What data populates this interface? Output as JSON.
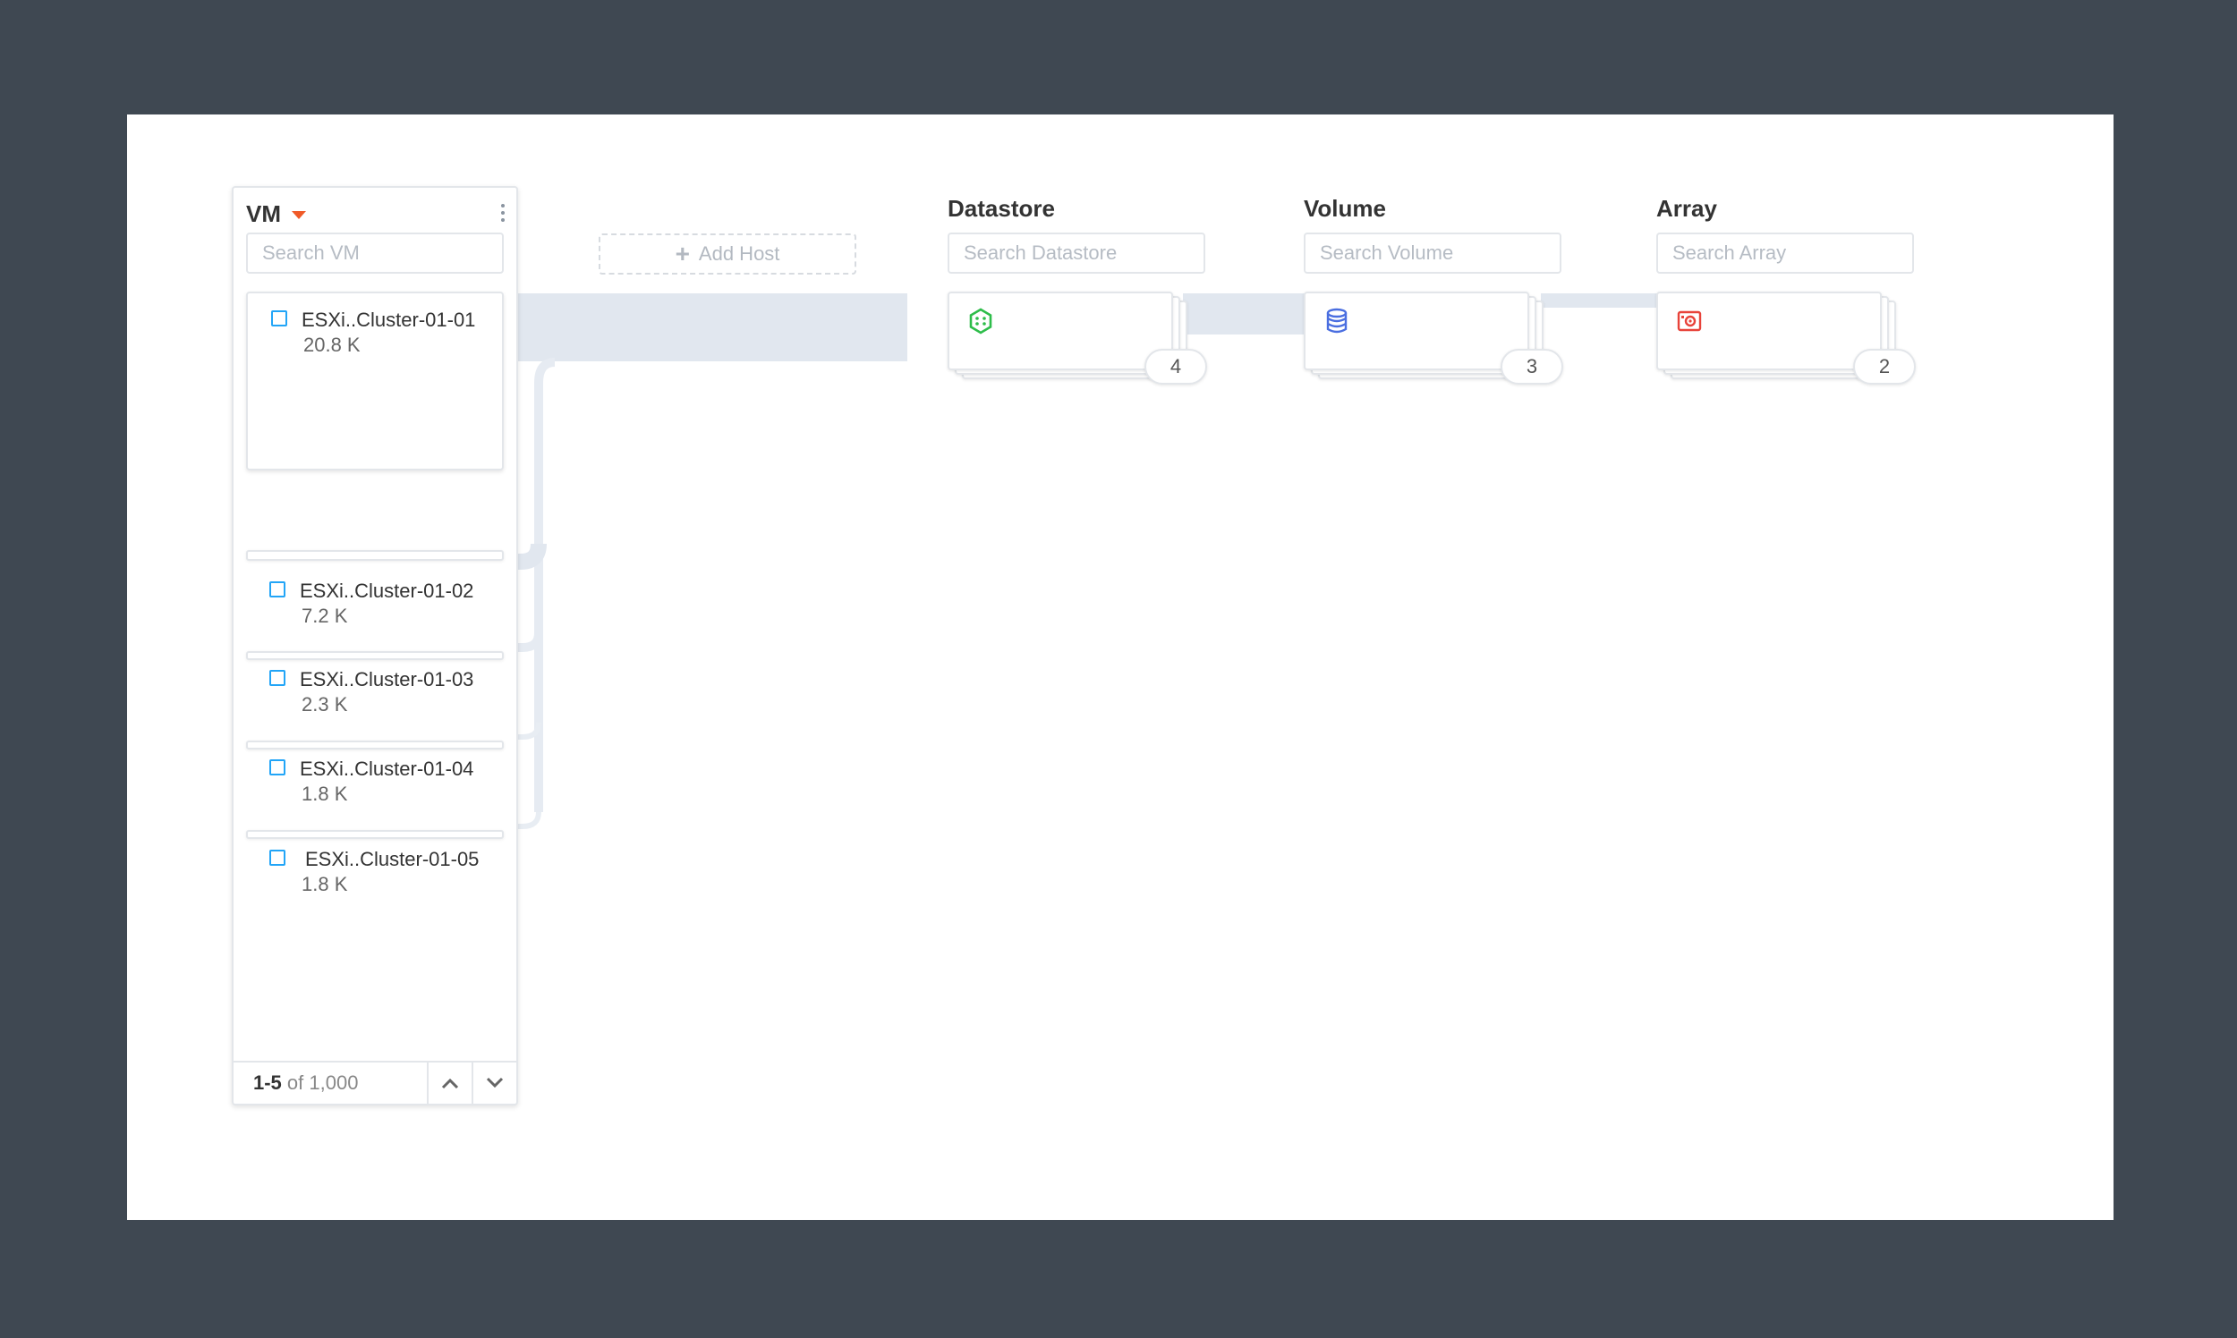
{
  "vm_column": {
    "title": "VM",
    "search_placeholder": "Search VM",
    "items": [
      {
        "name": "ESXi..Cluster-01-01",
        "count": "20.8 K"
      },
      {
        "name": "ESXi..Cluster-01-02",
        "count": "7.2 K"
      },
      {
        "name": "ESXi..Cluster-01-03",
        "count": "2.3 K"
      },
      {
        "name": "ESXi..Cluster-01-04",
        "count": "1.8 K"
      },
      {
        "name": "ESXi..Cluster-01-05",
        "count": "1.8 K"
      }
    ],
    "pager": {
      "range": "1-5",
      "of_text": "of 1,000"
    }
  },
  "add_host": {
    "label": "Add Host"
  },
  "datastore_column": {
    "title": "Datastore",
    "search_placeholder": "Search Datastore",
    "count": "4"
  },
  "volume_column": {
    "title": "Volume",
    "search_placeholder": "Search Volume",
    "count": "3"
  },
  "array_column": {
    "title": "Array",
    "search_placeholder": "Search Array",
    "count": "2"
  },
  "colors": {
    "background": "#3f4852",
    "flow": "#e1e7ef",
    "accent_orange": "#f05a28",
    "checkbox_blue": "#22a5f7",
    "datastore_icon": "#2ebd4a",
    "volume_icon": "#4a6ee0",
    "array_icon": "#e8433a"
  },
  "icons": [
    "caret-down-icon",
    "kebab-menu-icon",
    "plus-icon",
    "datastore-icon",
    "volume-icon",
    "array-icon",
    "chevron-up-icon",
    "chevron-down-icon"
  ]
}
